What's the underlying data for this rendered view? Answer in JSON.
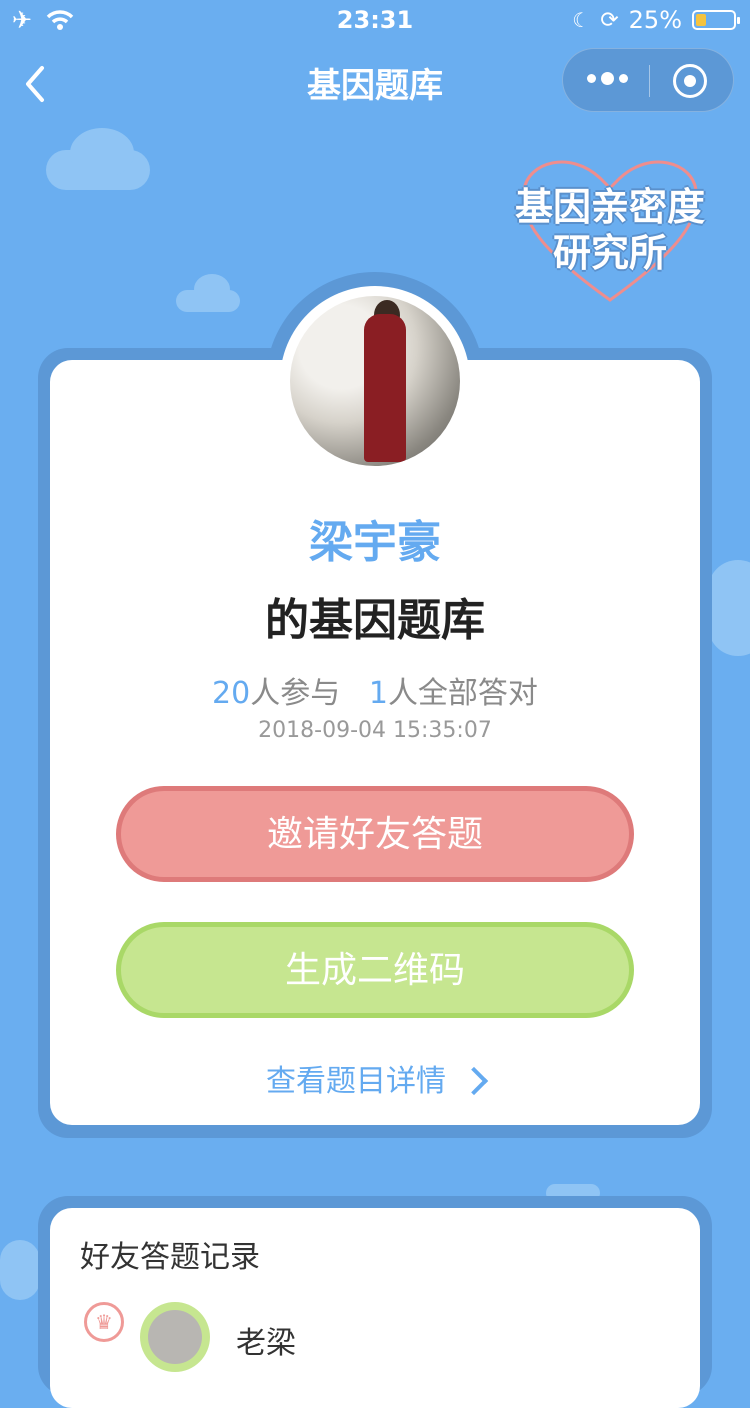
{
  "status_bar": {
    "time": "23:31",
    "battery": "25%"
  },
  "nav": {
    "title": "基因题库"
  },
  "logo": {
    "line1": "基因亲密度",
    "line2": "研究所"
  },
  "profile": {
    "name": "梁宇豪",
    "subtitle": "的基因题库"
  },
  "stats": {
    "participants": "20",
    "participants_label": "人参与",
    "all_correct": "1",
    "all_correct_label": "人全部答对"
  },
  "date": "2018-09-04 15:35:07",
  "buttons": {
    "invite": "邀请好友答题",
    "qrcode": "生成二维码"
  },
  "detail_link": "查看题目详情",
  "records": {
    "title": "好友答题记录",
    "items": [
      {
        "name": "老梁"
      }
    ]
  }
}
